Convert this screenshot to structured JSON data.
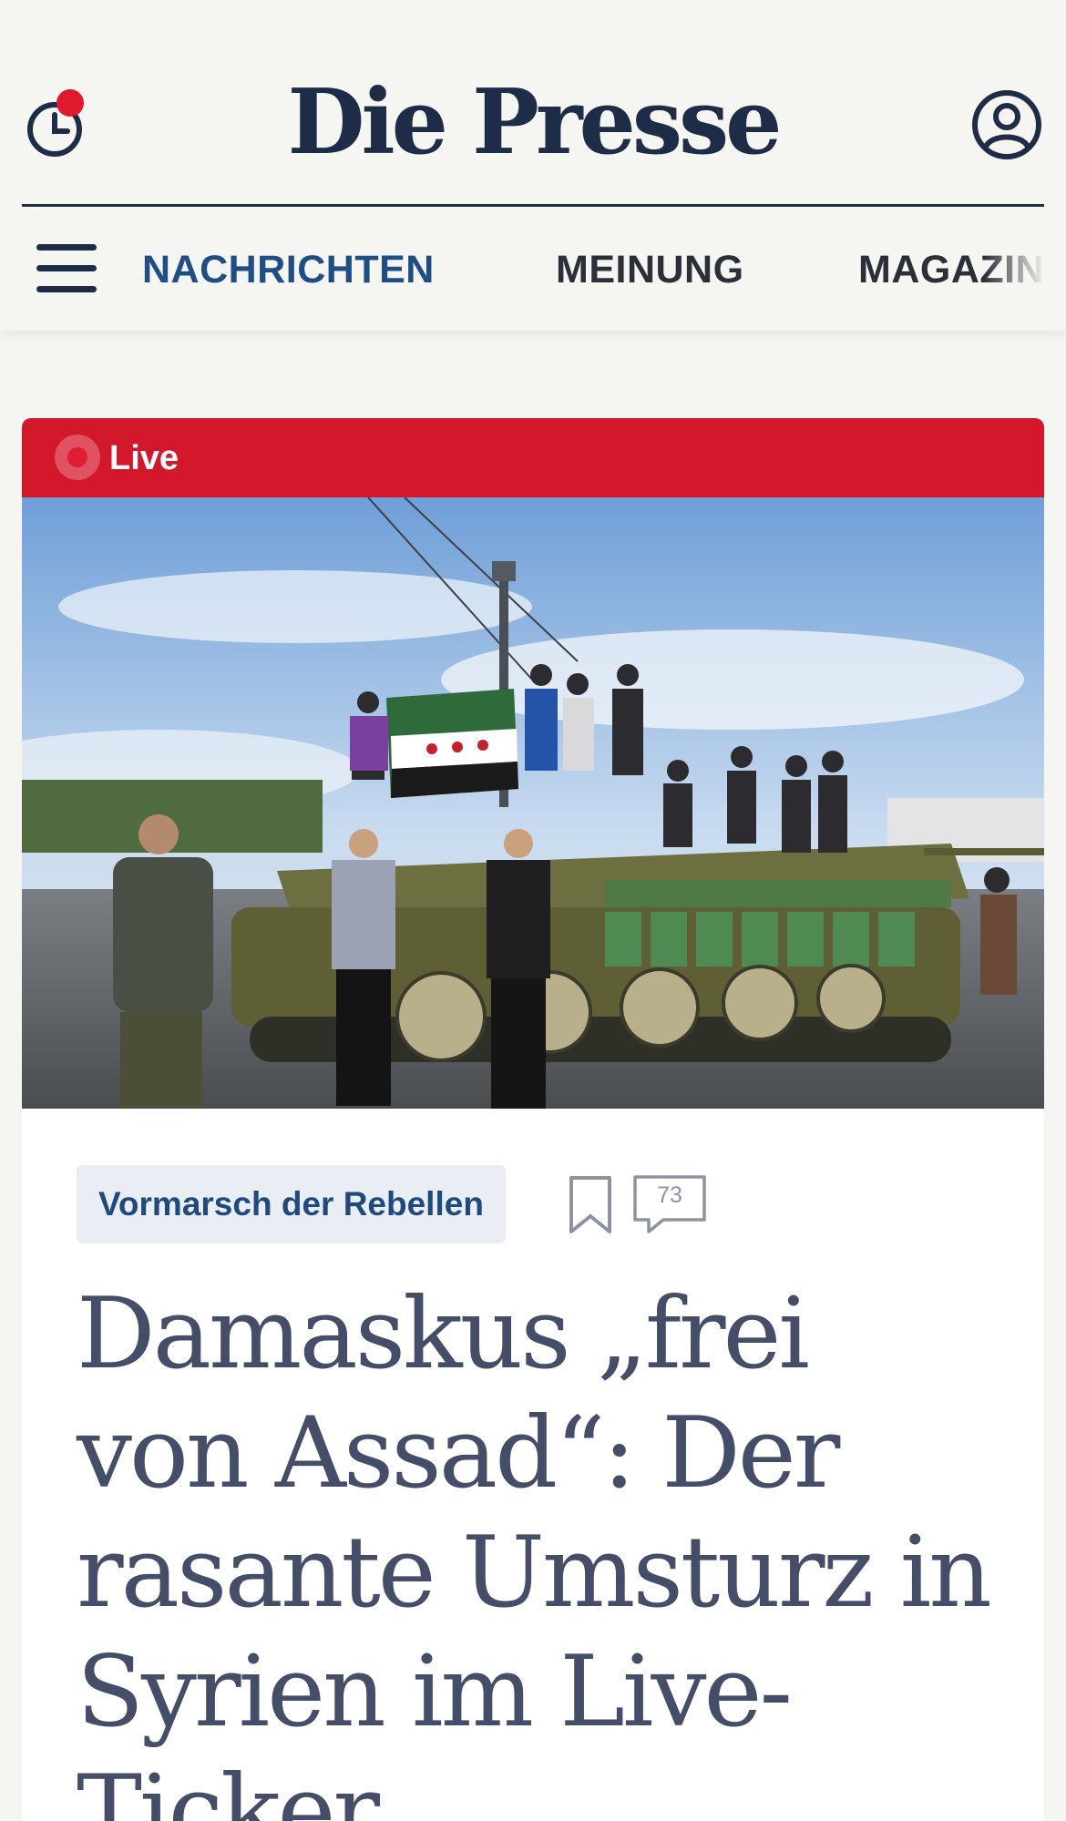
{
  "header": {
    "logo": "Die Presse",
    "nav": [
      "NACHRICHTEN",
      "MEINUNG",
      "MAGAZIN"
    ]
  },
  "article": {
    "live_label": "Live",
    "tag": "Vormarsch der Rebellen",
    "comment_count": "73",
    "headline": "Damaskus „frei von Assad“: Der rasante Umsturz in Syrien im Live-Ticker"
  },
  "colors": {
    "brand_navy": "#1e2d47",
    "live_red": "#d3182c",
    "nav_active": "#1f4d86",
    "headline": "#454e68"
  },
  "icons": {
    "history": "clock-history-icon",
    "account": "user-account-icon",
    "menu": "hamburger-menu-icon",
    "bookmark": "bookmark-icon",
    "comments": "comment-bubble-icon"
  }
}
